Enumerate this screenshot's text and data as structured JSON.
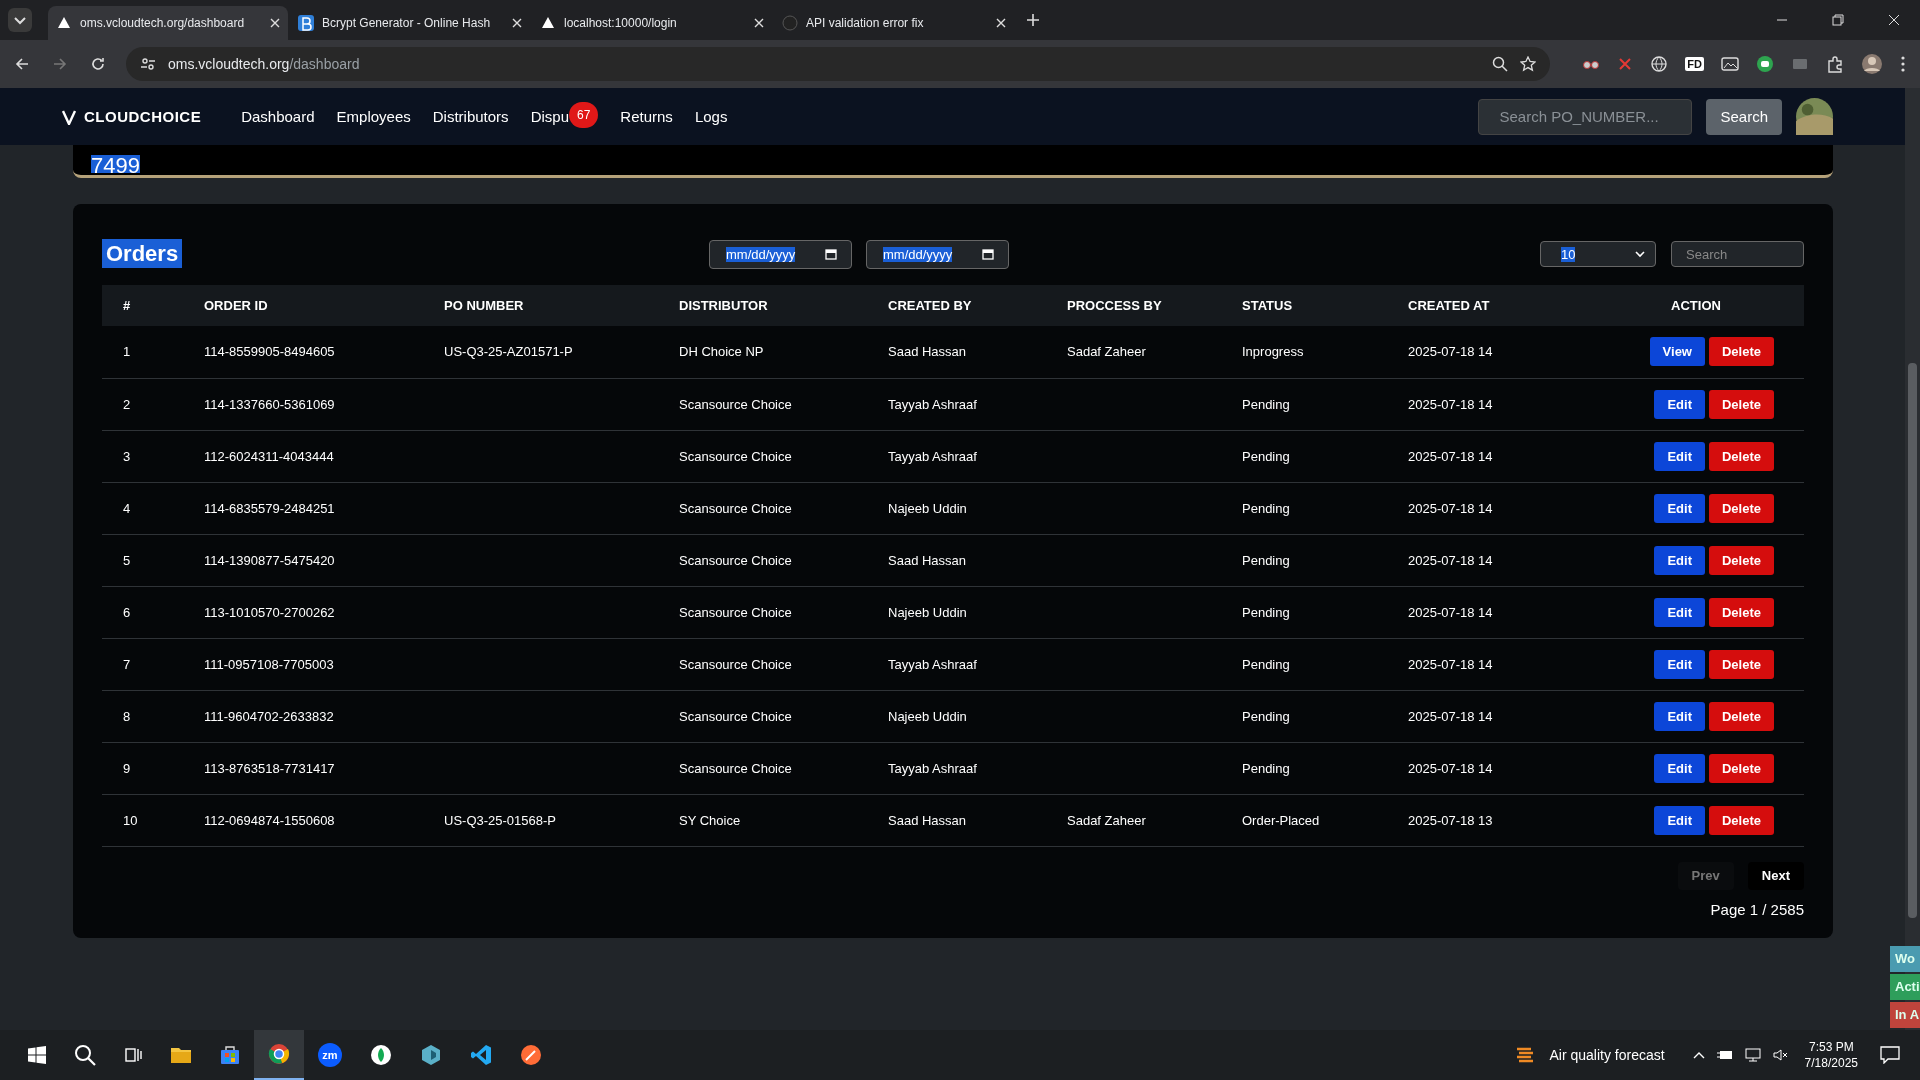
{
  "browser": {
    "tabs": [
      {
        "title": "oms.vcloudtech.org/dashboard",
        "selected": true,
        "kind": "site"
      },
      {
        "title": "Bcrypt Generator - Online Hash",
        "selected": false,
        "kind": "bcrypt"
      },
      {
        "title": "localhost:10000/login",
        "selected": false,
        "kind": "site"
      },
      {
        "title": "API validation error fix",
        "selected": false,
        "kind": "chat"
      }
    ],
    "address": {
      "host": "oms.vcloudtech.org",
      "path": "/dashboard"
    },
    "extension_label": "FD"
  },
  "nav": {
    "logo": "CLOUDCHOICE",
    "links": [
      {
        "label": "Dashboard"
      },
      {
        "label": "Employees"
      },
      {
        "label": "Distributors"
      },
      {
        "label": "Dispu",
        "badge": "67"
      },
      {
        "label": "Returns"
      },
      {
        "label": "Logs"
      }
    ],
    "search": {
      "placeholder": "Search PO_NUMBER..."
    },
    "search_button": "Search"
  },
  "top_card": {
    "value": "7499"
  },
  "orders": {
    "title": "Orders",
    "date_from": "mm/dd/yyyy",
    "date_to": "mm/dd/yyyy",
    "page_size": "10",
    "search": {
      "placeholder": "Search"
    },
    "columns": [
      "#",
      "ORDER ID",
      "PO NUMBER",
      "DISTRIBUTOR",
      "CREATED BY",
      "PROCCESS BY",
      "STATUS",
      "CREATED AT",
      "ACTION"
    ],
    "rows": [
      {
        "cells": [
          "1",
          "114-8559905-8494605",
          "US-Q3-25-AZ01571-P",
          "DH Choice NP",
          "Saad Hassan",
          "Sadaf Zaheer",
          "Inprogress",
          "2025-07-18 14"
        ],
        "actions": [
          {
            "label": "View",
            "kind": "view"
          },
          {
            "label": "Delete",
            "kind": "delete"
          }
        ]
      },
      {
        "cells": [
          "2",
          "114-1337660-5361069",
          "",
          "Scansource Choice",
          "Tayyab Ashraaf",
          "",
          "Pending",
          "2025-07-18 14"
        ],
        "actions": [
          {
            "label": "Edit",
            "kind": "edit"
          },
          {
            "label": "Delete",
            "kind": "delete"
          }
        ]
      },
      {
        "cells": [
          "3",
          "112-6024311-4043444",
          "",
          "Scansource Choice",
          "Tayyab Ashraaf",
          "",
          "Pending",
          "2025-07-18 14"
        ],
        "actions": [
          {
            "label": "Edit",
            "kind": "edit"
          },
          {
            "label": "Delete",
            "kind": "delete"
          }
        ]
      },
      {
        "cells": [
          "4",
          "114-6835579-2484251",
          "",
          "Scansource Choice",
          "Najeeb Uddin",
          "",
          "Pending",
          "2025-07-18 14"
        ],
        "actions": [
          {
            "label": "Edit",
            "kind": "edit"
          },
          {
            "label": "Delete",
            "kind": "delete"
          }
        ]
      },
      {
        "cells": [
          "5",
          "114-1390877-5475420",
          "",
          "Scansource Choice",
          "Saad Hassan",
          "",
          "Pending",
          "2025-07-18 14"
        ],
        "actions": [
          {
            "label": "Edit",
            "kind": "edit"
          },
          {
            "label": "Delete",
            "kind": "delete"
          }
        ]
      },
      {
        "cells": [
          "6",
          "113-1010570-2700262",
          "",
          "Scansource Choice",
          "Najeeb Uddin",
          "",
          "Pending",
          "2025-07-18 14"
        ],
        "actions": [
          {
            "label": "Edit",
            "kind": "edit"
          },
          {
            "label": "Delete",
            "kind": "delete"
          }
        ]
      },
      {
        "cells": [
          "7",
          "111-0957108-7705003",
          "",
          "Scansource Choice",
          "Tayyab Ashraaf",
          "",
          "Pending",
          "2025-07-18 14"
        ],
        "actions": [
          {
            "label": "Edit",
            "kind": "edit"
          },
          {
            "label": "Delete",
            "kind": "delete"
          }
        ]
      },
      {
        "cells": [
          "8",
          "111-9604702-2633832",
          "",
          "Scansource Choice",
          "Najeeb Uddin",
          "",
          "Pending",
          "2025-07-18 14"
        ],
        "actions": [
          {
            "label": "Edit",
            "kind": "edit"
          },
          {
            "label": "Delete",
            "kind": "delete"
          }
        ]
      },
      {
        "cells": [
          "9",
          "113-8763518-7731417",
          "",
          "Scansource Choice",
          "Tayyab Ashraaf",
          "",
          "Pending",
          "2025-07-18 14"
        ],
        "actions": [
          {
            "label": "Edit",
            "kind": "edit"
          },
          {
            "label": "Delete",
            "kind": "delete"
          }
        ]
      },
      {
        "cells": [
          "10",
          "112-0694874-1550608",
          "US-Q3-25-01568-P",
          "SY Choice",
          "Saad Hassan",
          "Sadaf Zaheer",
          "Order-Placed",
          "2025-07-18 13"
        ],
        "actions": [
          {
            "label": "Edit",
            "kind": "edit"
          },
          {
            "label": "Delete",
            "kind": "delete"
          }
        ]
      }
    ],
    "pagination": {
      "prev": {
        "label": "Prev",
        "disabled": true
      },
      "next": {
        "label": "Next",
        "disabled": false
      },
      "page_info": "Page 1 / 2585"
    }
  },
  "side_tabs": [
    {
      "label": "Wo",
      "color": "#4a9bb0"
    },
    {
      "label": "Acti",
      "color": "#2e9e5b"
    },
    {
      "label": "In A",
      "color": "#c0443c"
    }
  ],
  "taskbar": {
    "zoom_label": "zm",
    "weather": "Air quality forecast",
    "time": "7:53 PM",
    "date": "7/18/2025"
  }
}
